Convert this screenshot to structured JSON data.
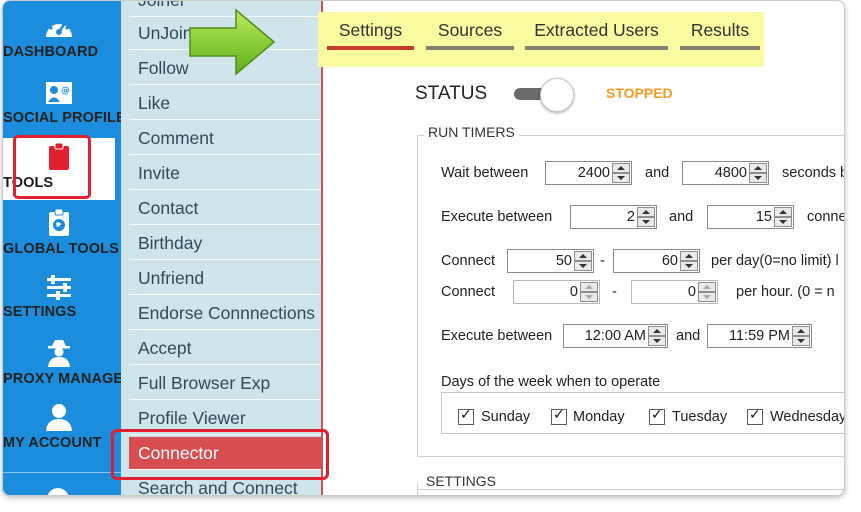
{
  "nav": {
    "items": [
      {
        "label": "DASHBOARD",
        "icon": "gauge-icon"
      },
      {
        "label": "SOCIAL PROFILES",
        "icon": "profile-card-icon"
      },
      {
        "label": "TOOLS",
        "icon": "clipboard-icon"
      },
      {
        "label": "GLOBAL TOOLS",
        "icon": "globe-clipboard-icon"
      },
      {
        "label": "SETTINGS",
        "icon": "sliders-icon"
      },
      {
        "label": "PROXY MANAGER",
        "icon": "spy-icon"
      },
      {
        "label": "MY ACCOUNT",
        "icon": "user-icon"
      }
    ],
    "active": "TOOLS"
  },
  "tools": {
    "items": [
      "Joiner",
      "UnJoin",
      "Follow",
      "Like",
      "Comment",
      "Invite",
      "Contact",
      "Birthday",
      "Unfriend",
      "Endorse Connnections",
      "Accept",
      "Full Browser Exp",
      "Profile Viewer",
      "Connector",
      "Search and Connect"
    ],
    "active": "Connector"
  },
  "tabs": [
    {
      "label": "Settings",
      "active": true
    },
    {
      "label": "Sources",
      "active": false
    },
    {
      "label": "Extracted Users",
      "active": false
    },
    {
      "label": "Results",
      "active": false
    }
  ],
  "status": {
    "label": "STATUS",
    "value": "STOPPED",
    "toggle_on": false
  },
  "run_timers": {
    "title": "RUN TIMERS",
    "wait": {
      "label": "Wait between",
      "from": "2400",
      "and": "and",
      "to": "4800",
      "suffix": "seconds b"
    },
    "execute": {
      "label": "Execute between",
      "from": "2",
      "and": "and",
      "to": "15",
      "suffix": "conne"
    },
    "connect_day": {
      "label": "Connect",
      "from": "50",
      "dash": "-",
      "to": "60",
      "suffix": "per day(0=no limit)  l"
    },
    "connect_hour": {
      "label": "Connect",
      "from": "0",
      "dash": "-",
      "to": "0",
      "suffix": "per hour. (0 = n"
    },
    "time_window": {
      "label": "Execute between",
      "from": "12:00 AM",
      "and": "and",
      "to": "11:59 PM"
    },
    "days": {
      "label": "Days of the week when to operate",
      "items": [
        {
          "name": "Sunday",
          "checked": true
        },
        {
          "name": "Monday",
          "checked": true
        },
        {
          "name": "Tuesday",
          "checked": true
        },
        {
          "name": "Wednesday",
          "checked": true
        }
      ]
    }
  },
  "settings_section": {
    "title": "SETTINGS"
  },
  "colors": {
    "nav_blue": "#1c8ddc",
    "active_red": "#d84d4f",
    "status_orange": "#f49b1f",
    "tab_highlight": "#fafaa0"
  }
}
